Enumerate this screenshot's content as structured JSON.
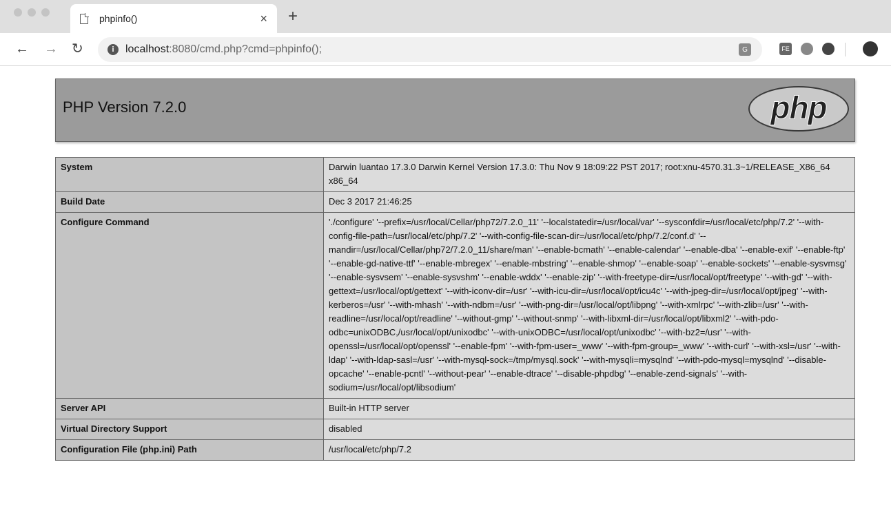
{
  "browser": {
    "tab_title": "phpinfo()",
    "tab_close": "×",
    "new_tab": "+",
    "url_host": "localhost",
    "url_rest": ":8080/cmd.php?cmd=phpinfo();"
  },
  "page": {
    "title": "PHP Version 7.2.0",
    "logo_text": "php",
    "rows": [
      {
        "key": "System",
        "value": "Darwin luantao 17.3.0 Darwin Kernel Version 17.3.0: Thu Nov 9 18:09:22 PST 2017; root:xnu-4570.31.3~1/RELEASE_X86_64 x86_64"
      },
      {
        "key": "Build Date",
        "value": "Dec 3 2017 21:46:25"
      },
      {
        "key": "Configure Command",
        "value": "'./configure' '--prefix=/usr/local/Cellar/php72/7.2.0_11' '--localstatedir=/usr/local/var' '--sysconfdir=/usr/local/etc/php/7.2' '--with-config-file-path=/usr/local/etc/php/7.2' '--with-config-file-scan-dir=/usr/local/etc/php/7.2/conf.d' '--mandir=/usr/local/Cellar/php72/7.2.0_11/share/man' '--enable-bcmath' '--enable-calendar' '--enable-dba' '--enable-exif' '--enable-ftp' '--enable-gd-native-ttf' '--enable-mbregex' '--enable-mbstring' '--enable-shmop' '--enable-soap' '--enable-sockets' '--enable-sysvmsg' '--enable-sysvsem' '--enable-sysvshm' '--enable-wddx' '--enable-zip' '--with-freetype-dir=/usr/local/opt/freetype' '--with-gd' '--with-gettext=/usr/local/opt/gettext' '--with-iconv-dir=/usr' '--with-icu-dir=/usr/local/opt/icu4c' '--with-jpeg-dir=/usr/local/opt/jpeg' '--with-kerberos=/usr' '--with-mhash' '--with-ndbm=/usr' '--with-png-dir=/usr/local/opt/libpng' '--with-xmlrpc' '--with-zlib=/usr' '--with-readline=/usr/local/opt/readline' '--without-gmp' '--without-snmp' '--with-libxml-dir=/usr/local/opt/libxml2' '--with-pdo-odbc=unixODBC,/usr/local/opt/unixodbc' '--with-unixODBC=/usr/local/opt/unixodbc' '--with-bz2=/usr' '--with-openssl=/usr/local/opt/openssl' '--enable-fpm' '--with-fpm-user=_www' '--with-fpm-group=_www' '--with-curl' '--with-xsl=/usr' '--with-ldap' '--with-ldap-sasl=/usr' '--with-mysql-sock=/tmp/mysql.sock' '--with-mysqli=mysqlnd' '--with-pdo-mysql=mysqlnd' '--disable-opcache' '--enable-pcntl' '--without-pear' '--enable-dtrace' '--disable-phpdbg' '--enable-zend-signals' '--with-sodium=/usr/local/opt/libsodium'"
      },
      {
        "key": "Server API",
        "value": "Built-in HTTP server"
      },
      {
        "key": "Virtual Directory Support",
        "value": "disabled"
      },
      {
        "key": "Configuration File (php.ini) Path",
        "value": "/usr/local/etc/php/7.2"
      }
    ]
  },
  "colors": {
    "header_bg": "#9b9b9b",
    "key_bg": "#c4c4c4",
    "value_bg": "#dcdcdc"
  },
  "icons": [
    "page-icon",
    "close-icon",
    "plus-icon",
    "back-arrow-icon",
    "forward-arrow-icon",
    "reload-icon",
    "site-info-icon",
    "translate-icon",
    "extension-icon",
    "profile-icon"
  ]
}
